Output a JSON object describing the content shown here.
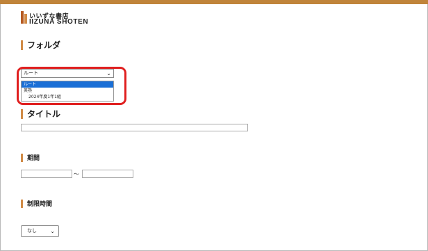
{
  "brand": {
    "name_jp": "いいずな書店",
    "name_en": "IIZUNA SHOTEN",
    "colors": {
      "accent": "#d08b47",
      "logo_dark": "#b65a22",
      "topbar": "#c0843a"
    }
  },
  "sections": {
    "folder": "フォルダ",
    "title": "タイトル",
    "period": "期間",
    "time_limit": "制限時間"
  },
  "folder_select": {
    "value": "ルート",
    "options": [
      "ルート",
      "英熟",
      "2024年度1年1組"
    ],
    "highlight_color": "#e02020",
    "selected_option_color": "#1a6fd6"
  },
  "title_field": {
    "value": ""
  },
  "period": {
    "start": "",
    "separator": "～",
    "end": ""
  },
  "time_limit_select": {
    "value": "なし"
  },
  "icons": {
    "dropdown": "chevron-down-icon"
  }
}
